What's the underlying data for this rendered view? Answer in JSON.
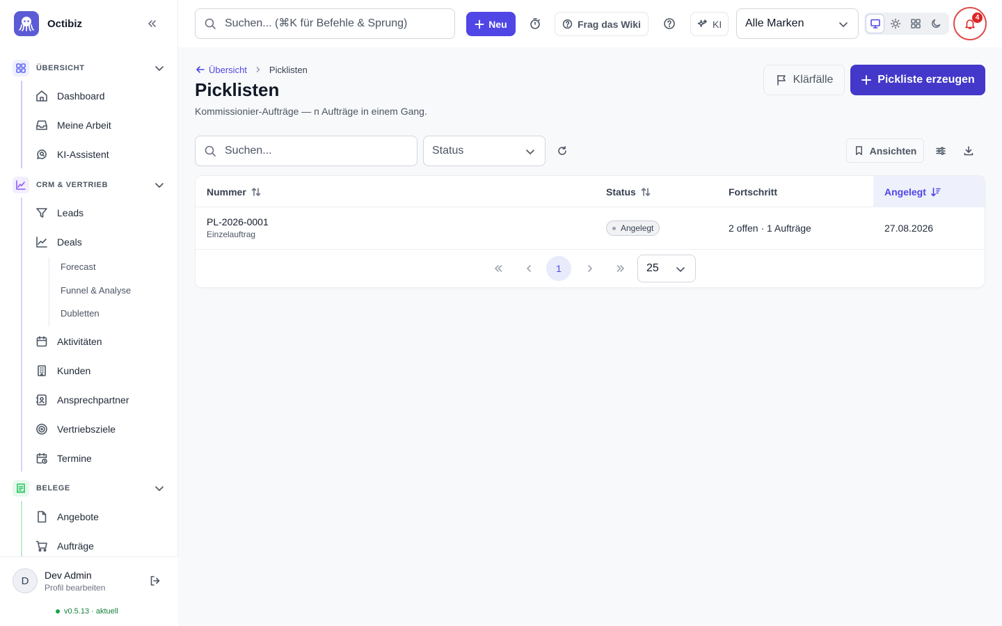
{
  "app": {
    "name": "Octibiz"
  },
  "topbar": {
    "search_placeholder": "Suchen... (⌘K für Befehle & Sprung)",
    "new_label": "Neu",
    "wiki_label": "Frag das Wiki",
    "ai_label": "KI",
    "brand_filter": "Alle Marken",
    "notification_count": "4"
  },
  "sidebar": {
    "sections": [
      {
        "label": "ÜBERSICHT",
        "items": [
          "Dashboard",
          "Meine Arbeit",
          "KI-Assistent"
        ]
      },
      {
        "label": "CRM & VERTRIEB",
        "items": [
          "Leads",
          "Deals",
          "Aktivitäten",
          "Kunden",
          "Ansprechpartner",
          "Vertriebsziele",
          "Termine"
        ],
        "deal_subitems": [
          "Forecast",
          "Funnel & Analyse",
          "Dubletten"
        ]
      },
      {
        "label": "BELEGE",
        "items": [
          "Angebote",
          "Aufträge"
        ]
      }
    ],
    "section_colors": [
      "#6366f1",
      "#8b5cf6",
      "#22c55e"
    ]
  },
  "user": {
    "initial": "D",
    "name": "Dev Admin",
    "profile_link": "Profil bearbeiten",
    "version": "v0.5.13 · aktuell"
  },
  "page": {
    "breadcrumb_back": "Übersicht",
    "breadcrumb_current": "Picklisten",
    "title": "Picklisten",
    "subtitle": "Kommissionier-Aufträge — n Aufträge in einem Gang.",
    "klaerfaelle_label": "Klärfälle",
    "create_label": "Pickliste erzeugen"
  },
  "filters": {
    "search_placeholder": "Suchen...",
    "status_placeholder": "Status",
    "views_label": "Ansichten"
  },
  "table": {
    "columns": [
      "Nummer",
      "Status",
      "Fortschritt",
      "Angelegt"
    ],
    "rows": [
      {
        "number": "PL-2026-0001",
        "type": "Einzelauftrag",
        "status": "Angelegt",
        "progress": "2 offen · 1 Aufträge",
        "created": "27.08.2026"
      }
    ]
  },
  "pagination": {
    "current_page": "1",
    "page_size": "25"
  },
  "colors": {
    "accent": "#4f46e5",
    "danger": "#dc2626",
    "success": "#16a34a"
  }
}
